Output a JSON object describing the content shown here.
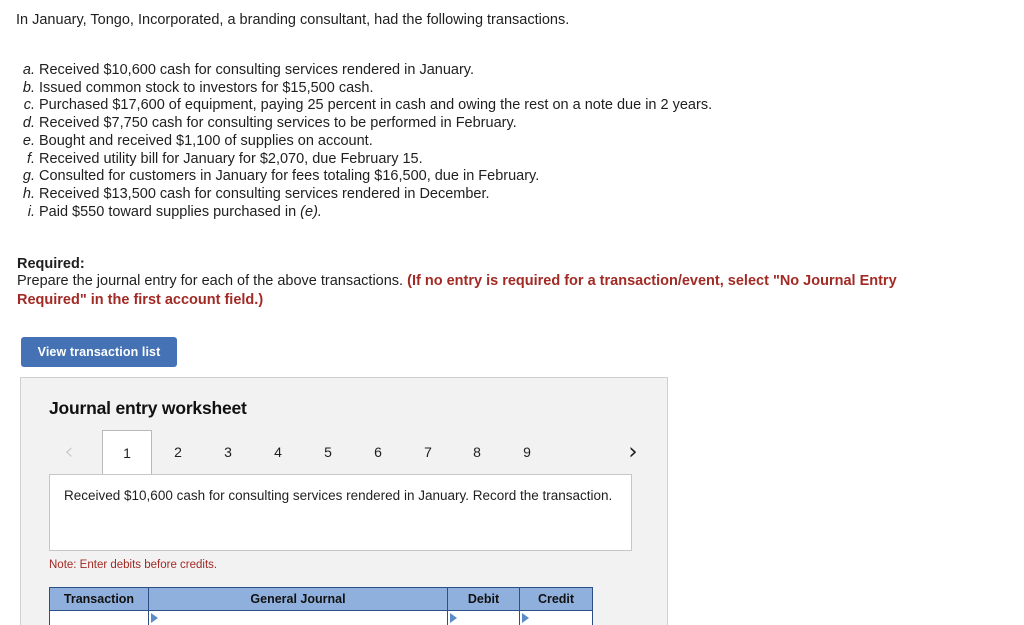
{
  "intro": "In January, Tongo, Incorporated, a branding consultant, had the following transactions.",
  "transactions": [
    {
      "letter": "a.",
      "text": "Received $10,600 cash for consulting services rendered in January."
    },
    {
      "letter": "b.",
      "text": "Issued common stock to investors for $15,500 cash."
    },
    {
      "letter": "c.",
      "text": "Purchased $17,600 of equipment, paying 25 percent in cash and owing the rest on a note due in 2 years."
    },
    {
      "letter": "d.",
      "text": "Received $7,750 cash for consulting services to be performed in February."
    },
    {
      "letter": "e.",
      "text": "Bought and received $1,100 of supplies on account."
    },
    {
      "letter": "f.",
      "text": "Received utility bill for January for $2,070, due February 15."
    },
    {
      "letter": "g.",
      "text": "Consulted for customers in January for fees totaling $16,500, due in February."
    },
    {
      "letter": "h.",
      "text": "Received $13,500 cash for consulting services rendered in December."
    },
    {
      "letter": "i.",
      "text": "Paid $550 toward supplies purchased in ",
      "text_italic": "(e).",
      "text_after": ""
    }
  ],
  "required": {
    "heading": "Required:",
    "body": "Prepare the journal entry for each of the above transactions. ",
    "warning": "(If no entry is required for a transaction/event, select \"No Journal Entry Required\" in the first account field.)"
  },
  "buttons": {
    "view_transaction_list": "View transaction list"
  },
  "worksheet": {
    "title": "Journal entry worksheet",
    "prev_icon": "chevron-left-icon",
    "next_icon": "chevron-right-icon",
    "prev_glyph": "‹",
    "next_glyph": "›",
    "tabs": [
      "1",
      "2",
      "3",
      "4",
      "5",
      "6",
      "7",
      "8",
      "9"
    ],
    "active_tab": "1",
    "description": "Received $10,600 cash for consulting services rendered in January. Record the transaction.",
    "note": "Note: Enter debits before credits.",
    "table": {
      "headers": [
        "Transaction",
        "General Journal",
        "Debit",
        "Credit"
      ],
      "rows": [
        {
          "transaction": "",
          "general_journal": "",
          "debit": "",
          "credit": ""
        }
      ]
    }
  },
  "colors": {
    "button_blue": "#4472b4",
    "header_blue": "#8fb0dd",
    "table_border_blue": "#2b4f86",
    "warning_red": "#a22a25",
    "panel_gray": "#f2f2f2",
    "marker_blue": "#5b8bc9"
  }
}
